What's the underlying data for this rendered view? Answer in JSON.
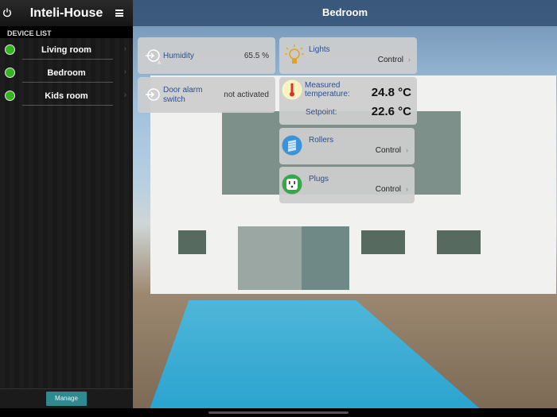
{
  "sidebar": {
    "title": "Inteli-House",
    "section": "DEVICE LIST",
    "rooms": [
      {
        "label": "Living room",
        "status": "online"
      },
      {
        "label": "Bedroom",
        "status": "online"
      },
      {
        "label": "Kids room",
        "status": "online"
      }
    ],
    "manage_label": "Manage"
  },
  "main": {
    "title": "Bedroom",
    "humidity": {
      "label": "Humidity",
      "value": "65.5 %"
    },
    "door": {
      "label": "Door alarm switch",
      "value": "not activated"
    },
    "lights": {
      "label": "Lights",
      "control": "Control"
    },
    "temperature": {
      "measured_label": "Measured temperature:",
      "measured": "24.8 °C",
      "setpoint_label": "Setpoint:",
      "setpoint": "22.6 °C"
    },
    "rollers": {
      "label": "Rollers",
      "control": "Control"
    },
    "plugs": {
      "label": "Plugs",
      "control": "Control"
    }
  },
  "colors": {
    "status_online": "#34b41e",
    "accent": "#2e8a91",
    "label_blue": "#2c4f8f"
  }
}
